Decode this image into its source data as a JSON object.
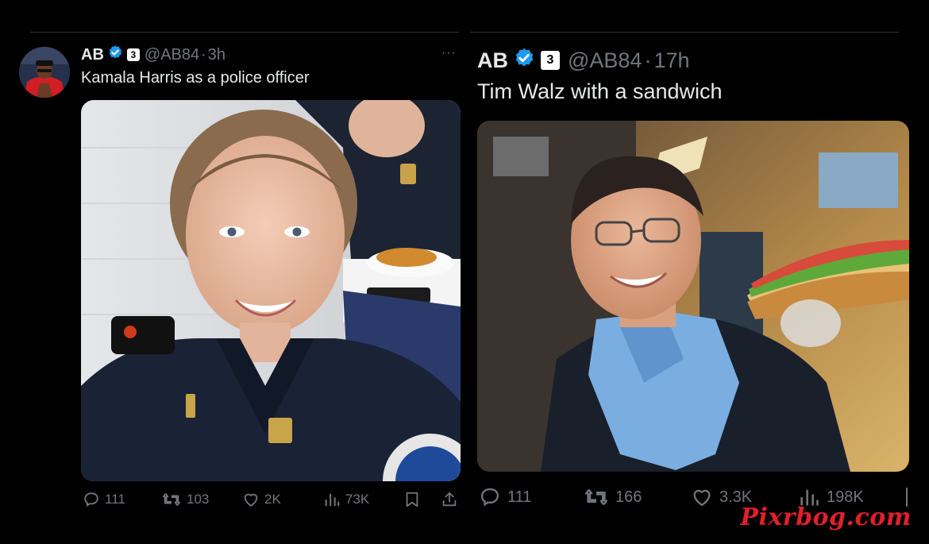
{
  "tweets": [
    {
      "author_name": "AB",
      "handle": "@AB84",
      "separator": "·",
      "time": "3h",
      "affiliate_badge": "3",
      "text": "Kamala Harris as a police officer",
      "image_alt": "Smiling female police officer in dark uniform seated at a table",
      "actions": {
        "replies": "111",
        "reposts": "103",
        "likes": "2K",
        "views": "73K"
      },
      "more_label": "···"
    },
    {
      "author_name": "AB",
      "handle": "@AB84",
      "separator": "·",
      "time": "17h",
      "affiliate_badge": "3",
      "text": "Tim Walz with a sandwich",
      "image_alt": "Smiling man with glasses in suit and blue shirt holding a sub sandwich",
      "actions": {
        "replies": "111",
        "reposts": "166",
        "likes": "3.3K",
        "views": "198K"
      }
    }
  ],
  "watermark": "Pixrbog.com",
  "colors": {
    "background": "#000000",
    "text_primary": "#e7e9ea",
    "text_secondary": "#71767b",
    "verified_blue": "#1d9bf0",
    "watermark_red": "#e0202a"
  }
}
